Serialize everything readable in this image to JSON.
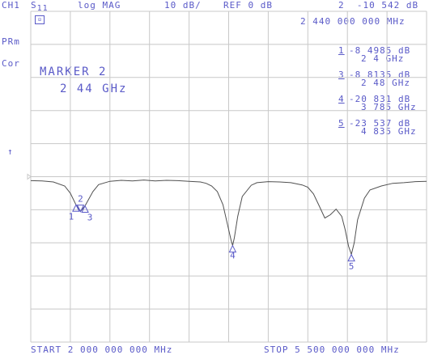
{
  "header": {
    "channel": "CH1",
    "parameter": "S",
    "parameter_sub": "11",
    "format": "log MAG",
    "scale": "10 dB/",
    "reference": "REF 0 dB",
    "active_marker_readout": "2  -10 542 dB",
    "active_marker_freq": "2 440 000 000 MHz"
  },
  "left_labels": {
    "prm": "PRm",
    "cor": "Cor",
    "ref_arrow": "↑"
  },
  "grid_icon": "␀",
  "marker_box": {
    "title": "MARKER 2",
    "freq": "2 44 GHz"
  },
  "marker_list": [
    {
      "num": "1",
      "value": "-8 4985 dB",
      "freq": "2 4 GHz"
    },
    {
      "num": "3",
      "value": "-8 8135 dB",
      "freq": "2 48 GHz"
    },
    {
      "num": "4",
      "value": "-20 831 dB",
      "freq": "3 785 GHz"
    },
    {
      "num": "5",
      "value": "-23 537 dB",
      "freq": "4 835 GHz"
    }
  ],
  "footer": {
    "start": "START 2 000 000 000 MHz",
    "stop": "STOP 5 500 000 000 MHz"
  },
  "colors": {
    "grid": "#c8c8c8",
    "text": "#5a5ac8",
    "trace": "#505050",
    "marker": "#5a5ac8"
  },
  "chart_data": {
    "type": "line",
    "x_unit": "GHz",
    "y_unit": "dB",
    "xlim": [
      2.0,
      5.5
    ],
    "ylim": [
      -50,
      0
    ],
    "grid": true,
    "series": [
      {
        "x": [
          2.0,
          2.1,
          2.2,
          2.3,
          2.35,
          2.4,
          2.44,
          2.48,
          2.55,
          2.6,
          2.7,
          2.8,
          2.9,
          3.0,
          3.1,
          3.2,
          3.3,
          3.4,
          3.5,
          3.55,
          3.6,
          3.65,
          3.7,
          3.74,
          3.77,
          3.785,
          3.8,
          3.83,
          3.87,
          3.95,
          4.0,
          4.1,
          4.2,
          4.3,
          4.4,
          4.45,
          4.5,
          4.55,
          4.6,
          4.65,
          4.7,
          4.75,
          4.78,
          4.81,
          4.835,
          4.86,
          4.89,
          4.95,
          5.0,
          5.1,
          5.2,
          5.3,
          5.4,
          5.5
        ],
        "y": [
          -1.2,
          -1.3,
          -1.6,
          -2.8,
          -5.0,
          -8.5,
          -10.5,
          -8.8,
          -4.5,
          -2.4,
          -1.4,
          -1.1,
          -1.3,
          -1.0,
          -1.3,
          -1.1,
          -1.2,
          -1.4,
          -1.6,
          -2.0,
          -2.8,
          -4.5,
          -8.5,
          -14.5,
          -19.0,
          -20.8,
          -18.5,
          -12.0,
          -6.0,
          -2.6,
          -1.8,
          -1.5,
          -1.6,
          -1.8,
          -2.5,
          -3.2,
          -5.2,
          -8.8,
          -12.5,
          -11.5,
          -9.8,
          -12.0,
          -16.0,
          -21.0,
          -23.5,
          -20.0,
          -13.0,
          -6.5,
          -4.0,
          -2.8,
          -2.0,
          -1.8,
          -1.5,
          -1.4
        ]
      }
    ],
    "markers": [
      {
        "label": "1",
        "x": 2.4,
        "y": -8.4985
      },
      {
        "label": "2",
        "x": 2.44,
        "y": -10.542
      },
      {
        "label": "3",
        "x": 2.48,
        "y": -8.8135
      },
      {
        "label": "4",
        "x": 3.785,
        "y": -20.831
      },
      {
        "label": "5",
        "x": 4.835,
        "y": -23.537
      }
    ]
  }
}
